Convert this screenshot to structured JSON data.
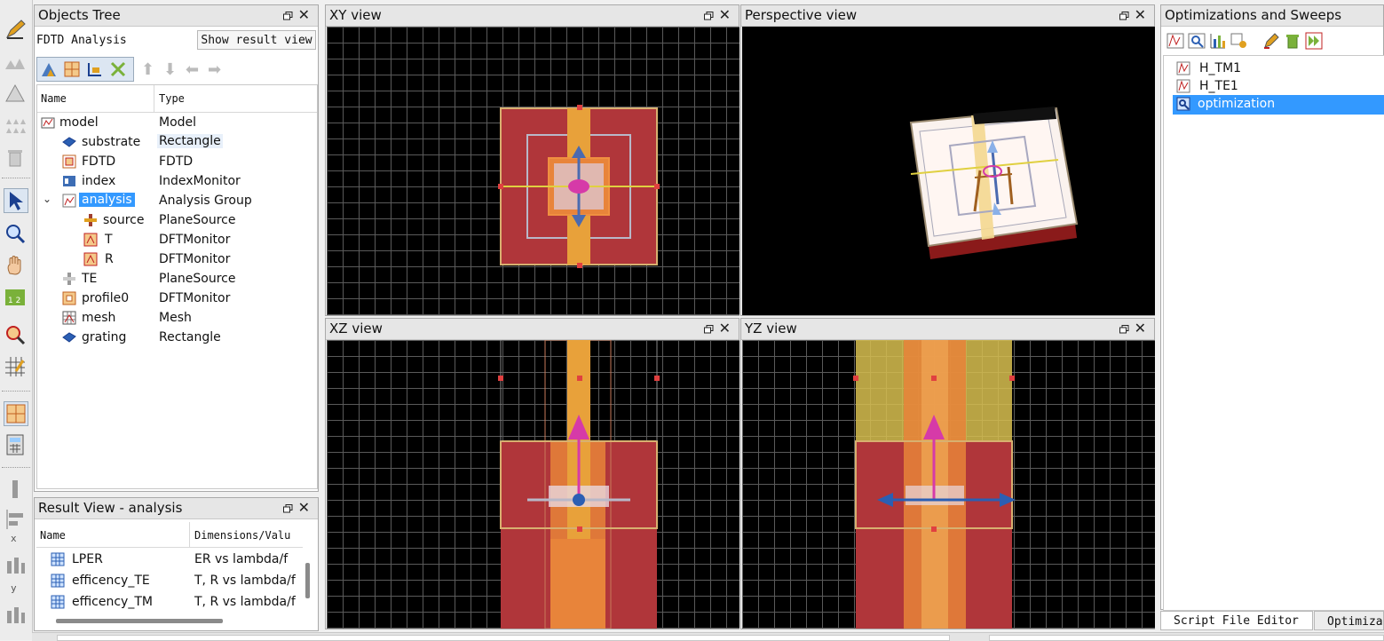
{
  "objects_tree": {
    "title": "Objects Tree",
    "analysis_label": "FDTD Analysis",
    "show_result_button": "Show result view",
    "col_name": "Name",
    "col_type": "Type",
    "rows": [
      {
        "name": "model",
        "type": "Model"
      },
      {
        "name": "substrate",
        "type": "Rectangle"
      },
      {
        "name": "FDTD",
        "type": "FDTD"
      },
      {
        "name": "index",
        "type": "IndexMonitor"
      },
      {
        "name": "analysis",
        "type": "Analysis Group"
      },
      {
        "name": "source",
        "type": "PlaneSource"
      },
      {
        "name": "T",
        "type": "DFTMonitor"
      },
      {
        "name": "R",
        "type": "DFTMonitor"
      },
      {
        "name": "TE",
        "type": "PlaneSource"
      },
      {
        "name": "profile0",
        "type": "DFTMonitor"
      },
      {
        "name": "mesh",
        "type": "Mesh"
      },
      {
        "name": "grating",
        "type": "Rectangle"
      }
    ]
  },
  "result_view": {
    "title": "Result View - analysis",
    "col_name": "Name",
    "col_dims": "Dimensions/Valu",
    "rows": [
      {
        "name": "LPER",
        "dims": "ER vs lambda/f"
      },
      {
        "name": "efficency_TE",
        "dims": "T, R vs lambda/f"
      },
      {
        "name": "efficency_TM",
        "dims": "T, R vs lambda/f"
      }
    ]
  },
  "views": {
    "xy": "XY view",
    "perspective": "Perspective view",
    "xz": "XZ view",
    "yz": "YZ view"
  },
  "optimizations": {
    "title": "Optimizations and Sweeps",
    "items": [
      "H_TM1",
      "H_TE1",
      "optimization"
    ],
    "selected": "optimization"
  },
  "bottom_tabs": {
    "script_editor": "Script File Editor",
    "optimiza": "Optimiza"
  },
  "colors": {
    "selection": "#3399ff",
    "substrate_red": "#b0363a",
    "waveguide_orange": "#e8a13a",
    "source_magenta": "#d63aa8",
    "viewport_bg": "#000000"
  }
}
